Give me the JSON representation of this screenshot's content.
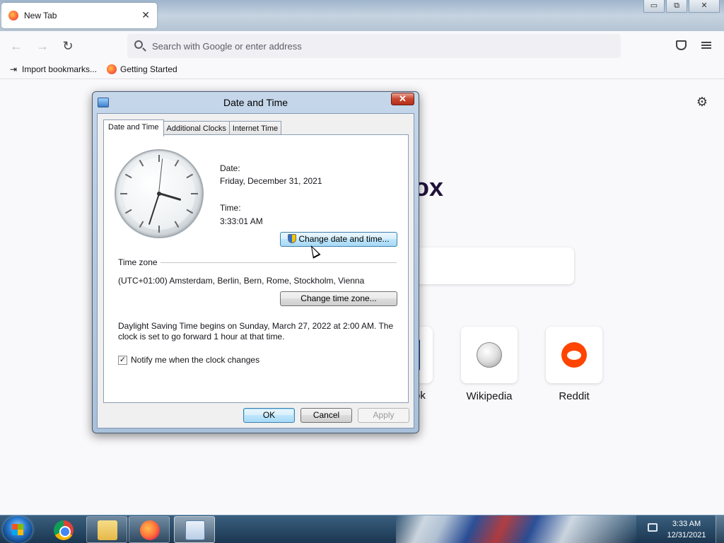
{
  "browser": {
    "tab_title": "New Tab",
    "tab_close": "✕",
    "window_controls": {
      "minimize": "▭",
      "restore": "⧉",
      "close": "✕"
    },
    "nav": {
      "back": "←",
      "forward": "→",
      "reload": "↻"
    },
    "address_placeholder": "Search with Google or enter address",
    "bookmarks": [
      {
        "label": "Import bookmarks...",
        "icon": "import-icon"
      },
      {
        "label": "Getting Started",
        "icon": "firefox-icon"
      }
    ]
  },
  "newtab": {
    "settings_icon": "⚙",
    "brand_fragment": "ox",
    "shortcuts": [
      {
        "label": "ok",
        "icon": "facebook-icon"
      },
      {
        "label": "Wikipedia",
        "icon": "wikipedia-icon"
      },
      {
        "label": "Reddit",
        "icon": "reddit-icon"
      }
    ]
  },
  "dialog": {
    "title": "Date and Time",
    "close": "✕",
    "tabs": [
      "Date and Time",
      "Additional Clocks",
      "Internet Time"
    ],
    "active_tab": 0,
    "date_label": "Date:",
    "date_value": "Friday, December 31, 2021",
    "time_label": "Time:",
    "time_value": "3:33:01 AM",
    "change_datetime_button": "Change date and time...",
    "timezone_header": "Time zone",
    "timezone_value": "(UTC+01:00) Amsterdam, Berlin, Bern, Rome, Stockholm, Vienna",
    "change_timezone_button": "Change time zone...",
    "dst_text": "Daylight Saving Time begins on Sunday, March 27, 2022 at 2:00 AM. The clock is set to go forward 1 hour at that time.",
    "notify_checkbox": {
      "label": "Notify me when the clock changes",
      "checked": true,
      "mark": "✓"
    },
    "buttons": {
      "ok": "OK",
      "cancel": "Cancel",
      "apply": "Apply"
    }
  },
  "taskbar": {
    "items": [
      "chrome-icon",
      "file-explorer-icon",
      "firefox-icon",
      "date-time-control-panel-icon"
    ],
    "time": "3:33 AM",
    "date": "12/31/2021"
  }
}
